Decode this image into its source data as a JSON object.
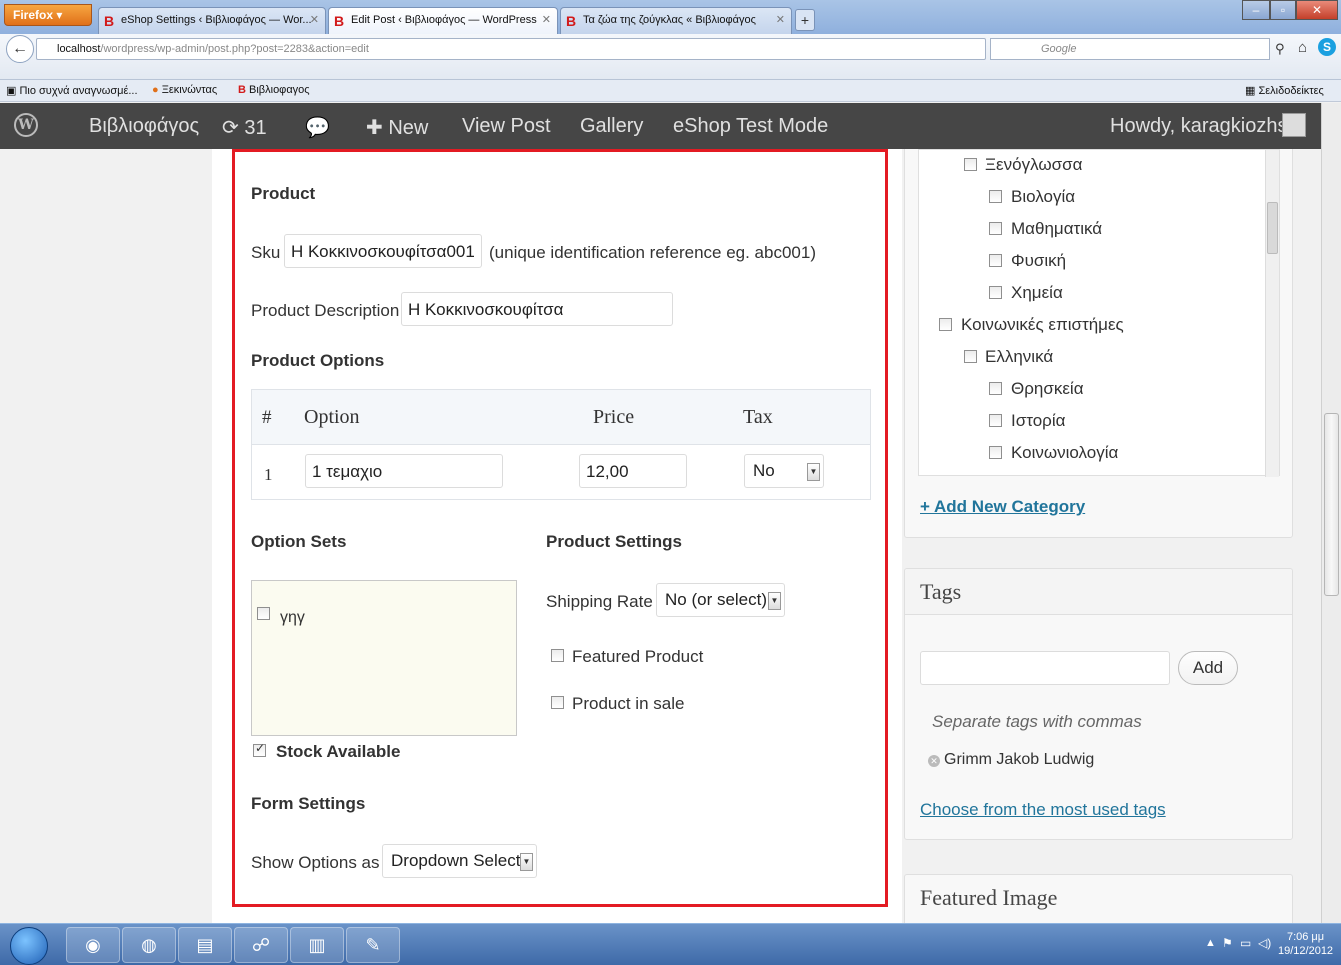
{
  "browser": {
    "firefox_button": "Firefox",
    "tabs": [
      {
        "label": "eShop Settings ‹ Βιβλιοφάγος — Wor..."
      },
      {
        "label": "Edit Post ‹ Βιβλιοφάγος — WordPress"
      },
      {
        "label": "Τα ζώα της ζούγκλας « Βιβλιοφάγος"
      }
    ],
    "url_host": "localhost",
    "url_path": "/wordpress/wp-admin/post.php?post=2283&action=edit",
    "search_placeholder": "Google",
    "bookmarks": [
      "Πιο συχνά αναγνωσμέ...",
      "Ξεκινώντας",
      "Βιβλιοφαγος"
    ],
    "bookmarks_menu": "Σελιδοδείκτες"
  },
  "adminbar": {
    "site_name": "Βιβλιοφάγος",
    "updates_count": "31",
    "new_label": "New",
    "view_post": "View Post",
    "gallery": "Gallery",
    "eshop_test": "eShop Test Mode",
    "howdy": "Howdy, karagkiozhs"
  },
  "product": {
    "heading": "Product",
    "sku_label": "Sku",
    "sku_value": "Η Κοκκινοσκουφίτσα001",
    "sku_hint": "(unique identification reference eg. abc001)",
    "desc_label": "Product Description",
    "desc_value": "Η Κοκκινοσκουφίτσα",
    "options_heading": "Product Options",
    "table": {
      "headers": [
        "#",
        "Option",
        "Price",
        "Tax"
      ],
      "rows": [
        {
          "num": "1",
          "option": "1 τεμαχιο",
          "price": "12,00",
          "tax": "No"
        }
      ]
    },
    "option_sets_heading": "Option Sets",
    "option_sets": [
      {
        "label": "γηγ",
        "checked": false
      }
    ],
    "stock_available": "Stock Available",
    "settings_heading": "Product Settings",
    "shipping_label": "Shipping Rate",
    "shipping_value": "No (or select)",
    "featured_label": "Featured Product",
    "sale_label": "Product in sale",
    "form_heading": "Form Settings",
    "show_options_label": "Show Options as",
    "show_options_value": "Dropdown Select"
  },
  "categories": {
    "items": [
      {
        "label": "Ξενόγλωσσα",
        "level": 1
      },
      {
        "label": "Βιολογία",
        "level": 2
      },
      {
        "label": "Μαθηματικά",
        "level": 2
      },
      {
        "label": "Φυσική",
        "level": 2
      },
      {
        "label": "Χημεία",
        "level": 2
      },
      {
        "label": "Κοινωνικές επιστήμες",
        "level": 0
      },
      {
        "label": "Ελληνικά",
        "level": 1
      },
      {
        "label": "Θρησκεία",
        "level": 2
      },
      {
        "label": "Ιστορία",
        "level": 2
      },
      {
        "label": "Κοινωνιολογία",
        "level": 2
      }
    ],
    "add_new": "+ Add New Category"
  },
  "tags": {
    "title": "Tags",
    "input_value": "",
    "add_button": "Add",
    "hint": "Separate tags with commas",
    "existing": [
      "Grimm Jakob Ludwig"
    ],
    "most_used_link": "Choose from the most used tags"
  },
  "featured_image": {
    "title": "Featured Image"
  },
  "taskbar": {
    "time": "7:06 μμ",
    "date": "19/12/2012"
  },
  "colors": {
    "highlight": "#e31b23",
    "adminbar": "#464646",
    "link": "#21759b"
  }
}
